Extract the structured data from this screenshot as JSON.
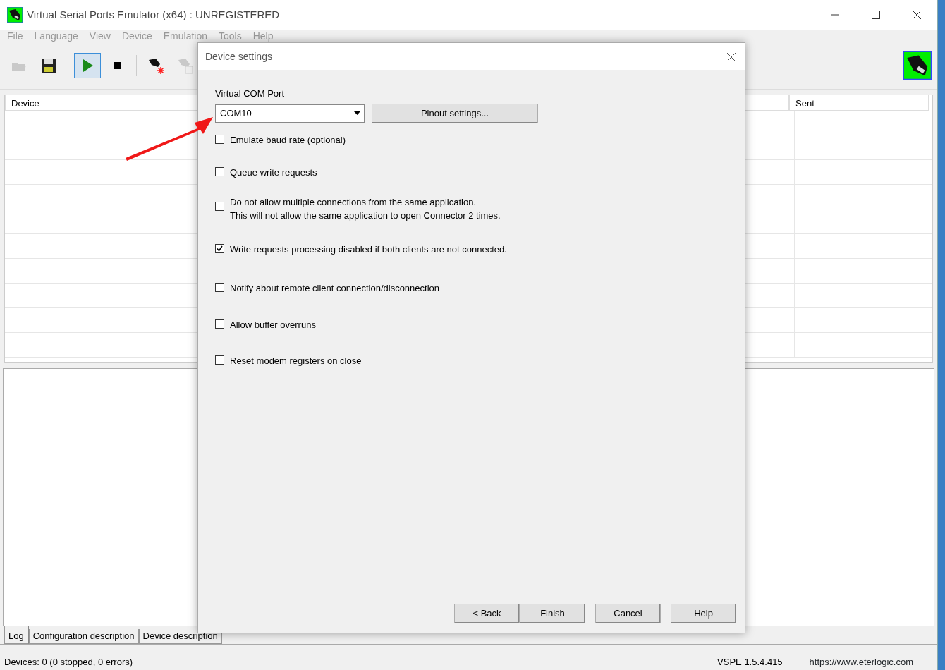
{
  "window": {
    "title": "Virtual Serial Ports Emulator (x64) : UNREGISTERED"
  },
  "menu": [
    "File",
    "Language",
    "View",
    "Device",
    "Emulation",
    "Tools",
    "Help"
  ],
  "toolbar": [
    {
      "kind": "open",
      "disabled": true,
      "pressed": false
    },
    {
      "kind": "save",
      "disabled": false,
      "pressed": false
    },
    {
      "kind": "sep"
    },
    {
      "kind": "start",
      "disabled": false,
      "pressed": true
    },
    {
      "kind": "stop",
      "disabled": false,
      "pressed": false
    },
    {
      "kind": "sep"
    },
    {
      "kind": "create",
      "disabled": false,
      "pressed": false
    },
    {
      "kind": "edit",
      "disabled": true,
      "pressed": false
    }
  ],
  "table": {
    "columns": [
      "Device",
      "Sent"
    ]
  },
  "log_tabs": [
    {
      "label": "Log",
      "selected": true
    },
    {
      "label": "Configuration description",
      "selected": false
    },
    {
      "label": "Device description",
      "selected": false
    }
  ],
  "status_bar": {
    "devices": "Devices: 0 (0 stopped, 0 errors)",
    "version": "VSPE 1.5.4.415",
    "link": "https://www.eterlogic.com"
  },
  "dialog": {
    "title": "Device settings",
    "port_label": "Virtual COM Port",
    "port": {
      "value": "COM10"
    },
    "pinout_button": "Pinout settings...",
    "options": [
      {
        "lines": [
          "Emulate baud rate (optional)"
        ],
        "checked": false
      },
      {
        "lines": [
          "Queue write requests"
        ],
        "checked": false
      },
      {
        "lines": [
          "Do not allow multiple connections from the same application.",
          "This will not allow the same application to open Connector 2 times."
        ],
        "checked": false
      },
      {
        "lines": [
          "Write requests processing disabled if both clients are not connected."
        ],
        "checked": true
      },
      {
        "lines": [
          "Notify about remote client connection/disconnection"
        ],
        "checked": false
      },
      {
        "lines": [
          "Allow buffer overruns"
        ],
        "checked": false
      },
      {
        "lines": [
          "Reset modem registers on close"
        ],
        "checked": false
      }
    ],
    "buttons": [
      "< Back",
      "Finish",
      "Cancel",
      "Help"
    ]
  }
}
